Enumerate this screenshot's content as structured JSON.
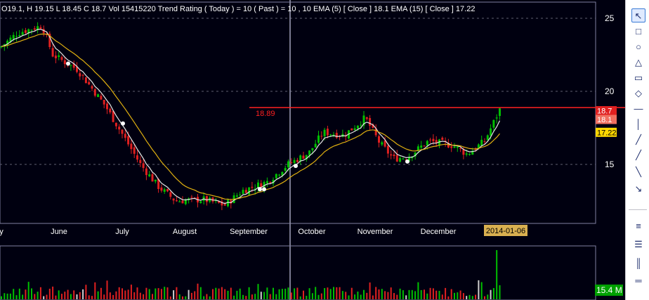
{
  "header": {
    "text": "O19.1, H 19.15 L 18.45 C 18.7  Vol 15415220  Trend Rating ( Today ) =    10 ( Past ) =    10 , 10   EMA  (5)  [ Close ] 18.1    EMA  (15)  [ Close ] 17.22"
  },
  "chart_data": {
    "type": "candlestick",
    "x_labels": [
      "y",
      "June",
      "July",
      "August",
      "September",
      "October",
      "November",
      "December"
    ],
    "cursor_date_label": "2014-01-06",
    "y_ticks": [
      "25",
      "20",
      "15"
    ],
    "ylim": [
      10.9,
      25.5
    ],
    "resistance": {
      "label": "18.89",
      "value": 18.89,
      "color": "#ff2020"
    },
    "price_tags": [
      {
        "label": "18.7",
        "value": 18.7,
        "bg": "#e02020",
        "fg": "#ffffff"
      },
      {
        "label": "18.1",
        "value": 18.1,
        "bg": "#f07060",
        "fg": "#ffffff"
      },
      {
        "label": "17.22",
        "value": 17.22,
        "bg": "#ffd800",
        "fg": "#000000"
      }
    ],
    "ema_colors": {
      "ema5": "#e6e6e6",
      "ema15": "#e0b010"
    },
    "volume_label": "15.4 M",
    "candle_colors": {
      "up": "#00c000",
      "down": "#e02020"
    },
    "highlight_marker_color": "#ffffff"
  },
  "toolbar": {
    "icons": [
      "cursor-icon",
      "rectangle-icon",
      "ellipse-icon",
      "triangle-icon",
      "rounded-rect-icon",
      "rhombus-icon",
      "hline-icon",
      "vline-icon",
      "line-icon",
      "line2-icon",
      "line3-icon",
      "arrow-icon",
      "equals-icon",
      "fib-icon",
      "cycle-icon",
      "gann-icon",
      "text-icon"
    ]
  }
}
